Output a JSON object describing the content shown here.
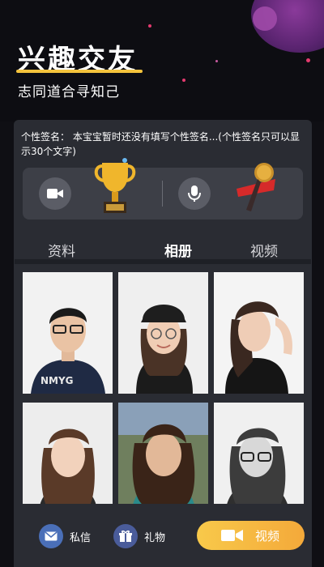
{
  "hero": {
    "title": "兴趣交友",
    "subtitle": "志同道合寻知己"
  },
  "profile": {
    "signature": "个性签名：   本宝宝暂时还没有填写个性签名...(个性签名只可以显示30个文字)"
  },
  "tabs": [
    {
      "label": "资料"
    },
    {
      "label": "相册"
    },
    {
      "label": "视频"
    }
  ],
  "active_tab": "相册",
  "album": {
    "photos": [
      {
        "icon": "man-with-glasses-portrait"
      },
      {
        "icon": "woman-with-cap-portrait"
      },
      {
        "icon": "woman-hand-on-head-portrait"
      },
      {
        "icon": "woman-long-hair-portrait"
      },
      {
        "icon": "woman-outdoor-portrait"
      },
      {
        "icon": "woman-glasses-bw-portrait"
      }
    ]
  },
  "bottom": {
    "message_label": "私信",
    "gift_label": "礼物",
    "video_label": "视频"
  },
  "colors": {
    "accent": "#f4c33c",
    "panel": "#2a2c33",
    "message_icon": "#4a6fb8",
    "gift_icon": "#4a5c9a"
  }
}
